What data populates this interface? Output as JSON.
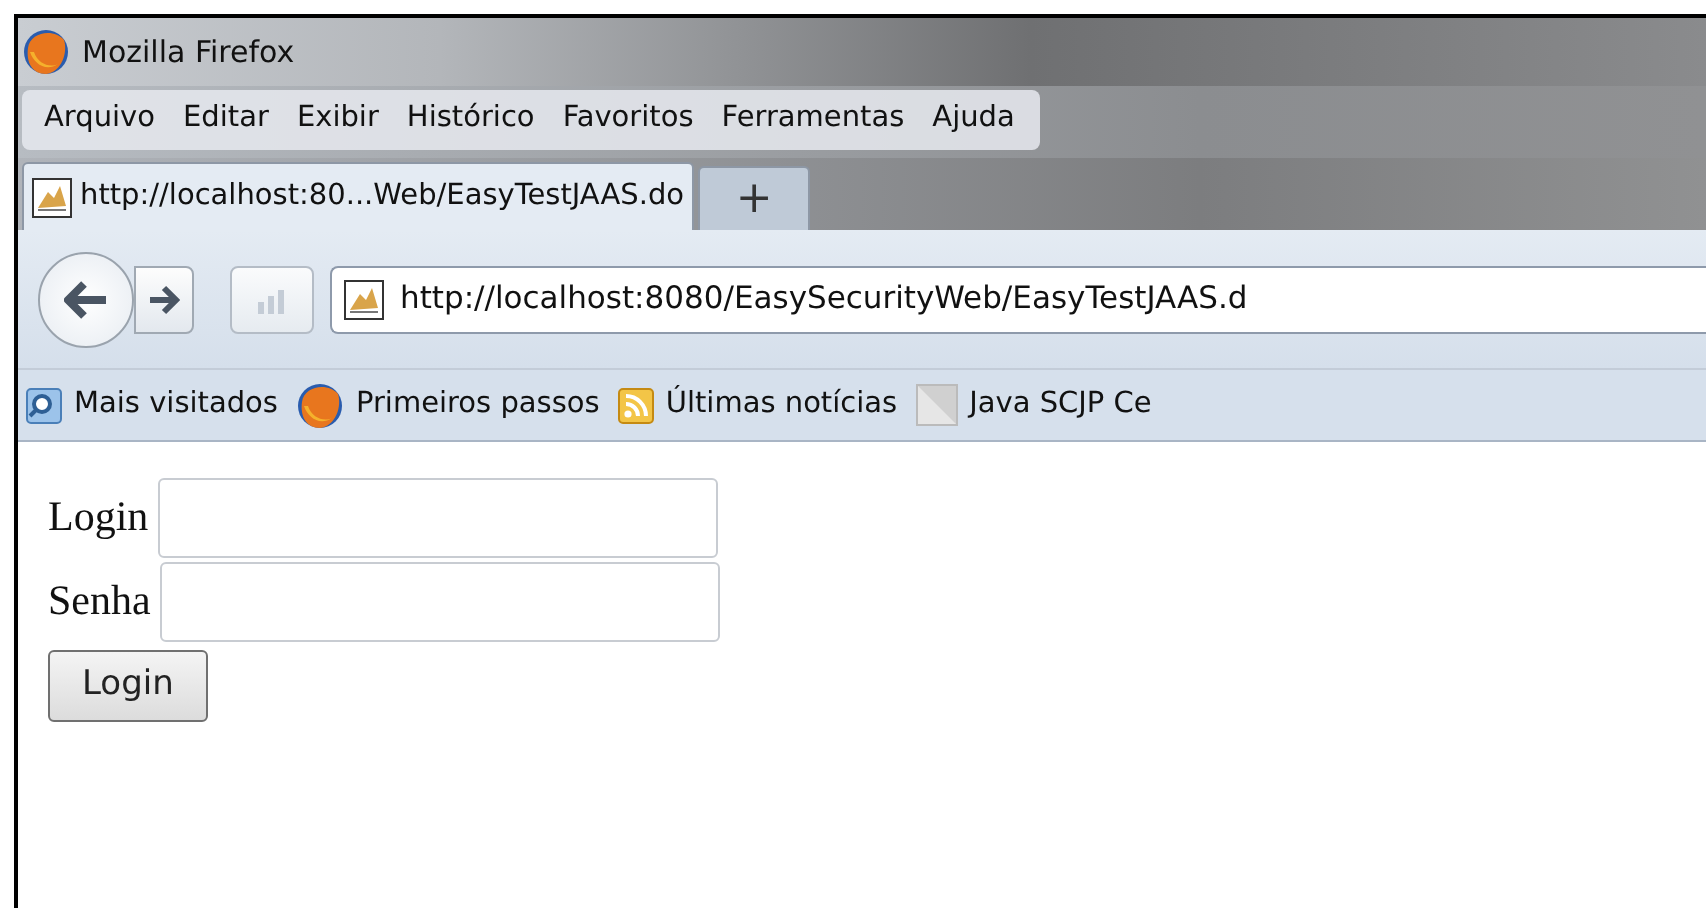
{
  "window": {
    "title": "Mozilla Firefox"
  },
  "menu": [
    "Arquivo",
    "Editar",
    "Exibir",
    "Histórico",
    "Favoritos",
    "Ferramentas",
    "Ajuda"
  ],
  "tabs": [
    {
      "label": "http://localhost:80...Web/EasyTestJAAS.do",
      "selected": true
    }
  ],
  "new_tab": "+",
  "address": {
    "value": "http://localhost:8080/EasySecurityWeb/EasyTestJAAS.d"
  },
  "bookmarks": [
    {
      "label": "Mais visitados",
      "kind": "search"
    },
    {
      "label": "Primeiros passos",
      "kind": "firefox"
    },
    {
      "label": "Últimas notícias",
      "kind": "feed"
    },
    {
      "label": "Java SCJP Ce",
      "kind": "page"
    }
  ],
  "form": {
    "fields": [
      {
        "label": "Login"
      },
      {
        "label": "Senha"
      }
    ],
    "button": "Login"
  }
}
